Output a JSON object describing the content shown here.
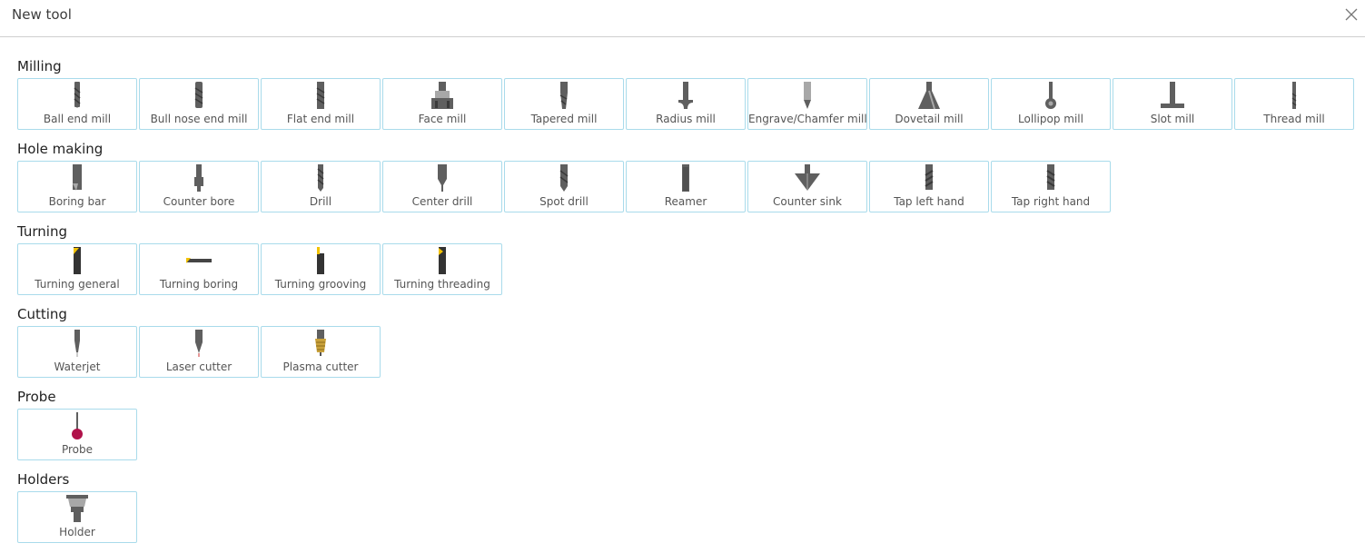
{
  "dialog": {
    "title": "New tool",
    "close_icon": "close-icon"
  },
  "sections": [
    {
      "title": "Milling",
      "tools": [
        {
          "label": "Ball end mill",
          "icon": "ball-end-mill-icon"
        },
        {
          "label": "Bull nose end mill",
          "icon": "bull-nose-end-mill-icon"
        },
        {
          "label": "Flat end mill",
          "icon": "flat-end-mill-icon"
        },
        {
          "label": "Face mill",
          "icon": "face-mill-icon"
        },
        {
          "label": "Tapered mill",
          "icon": "tapered-mill-icon"
        },
        {
          "label": "Radius mill",
          "icon": "radius-mill-icon"
        },
        {
          "label": "Engrave/Chamfer mill",
          "icon": "engrave-chamfer-mill-icon"
        },
        {
          "label": "Dovetail mill",
          "icon": "dovetail-mill-icon"
        },
        {
          "label": "Lollipop mill",
          "icon": "lollipop-mill-icon"
        },
        {
          "label": "Slot mill",
          "icon": "slot-mill-icon"
        },
        {
          "label": "Thread mill",
          "icon": "thread-mill-icon"
        }
      ]
    },
    {
      "title": "Hole making",
      "tools": [
        {
          "label": "Boring bar",
          "icon": "boring-bar-icon"
        },
        {
          "label": "Counter bore",
          "icon": "counter-bore-icon"
        },
        {
          "label": "Drill",
          "icon": "drill-icon"
        },
        {
          "label": "Center drill",
          "icon": "center-drill-icon"
        },
        {
          "label": "Spot drill",
          "icon": "spot-drill-icon"
        },
        {
          "label": "Reamer",
          "icon": "reamer-icon"
        },
        {
          "label": "Counter sink",
          "icon": "counter-sink-icon"
        },
        {
          "label": "Tap left hand",
          "icon": "tap-left-hand-icon"
        },
        {
          "label": "Tap right hand",
          "icon": "tap-right-hand-icon"
        }
      ]
    },
    {
      "title": "Turning",
      "tools": [
        {
          "label": "Turning general",
          "icon": "turning-general-icon"
        },
        {
          "label": "Turning boring",
          "icon": "turning-boring-icon"
        },
        {
          "label": "Turning grooving",
          "icon": "turning-grooving-icon"
        },
        {
          "label": "Turning threading",
          "icon": "turning-threading-icon"
        }
      ]
    },
    {
      "title": "Cutting",
      "tools": [
        {
          "label": "Waterjet",
          "icon": "waterjet-icon"
        },
        {
          "label": "Laser cutter",
          "icon": "laser-cutter-icon"
        },
        {
          "label": "Plasma cutter",
          "icon": "plasma-cutter-icon"
        }
      ]
    },
    {
      "title": "Probe",
      "tools": [
        {
          "label": "Probe",
          "icon": "probe-icon"
        }
      ]
    },
    {
      "title": "Holders",
      "tools": [
        {
          "label": "Holder",
          "icon": "holder-icon"
        }
      ]
    }
  ],
  "colors": {
    "tile_border": "#a9dbeb",
    "header_border": "#cfcfcf",
    "tool_metal": "#6e6e6e",
    "insert": "#f2c200",
    "probe_tip": "#b0124a",
    "plasma_brass": "#c9a13a"
  }
}
